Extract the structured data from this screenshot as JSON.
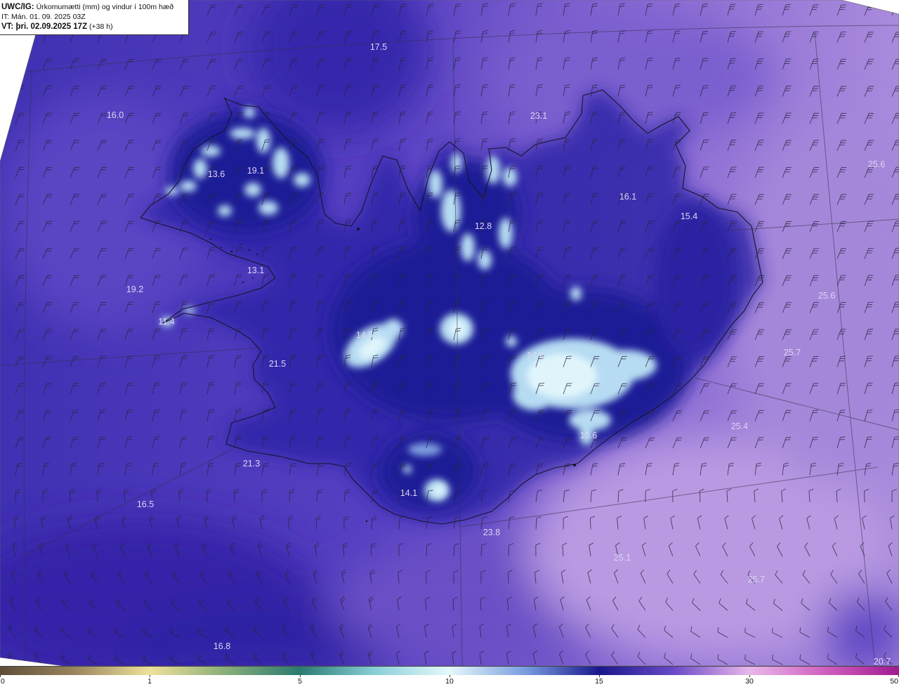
{
  "header": {
    "product": "UWC/IG:",
    "title": "Úrkomumætti (mm) og vindur í 100m hæð",
    "init_time": "IT: Mán. 01. 09. 2025 03Z",
    "valid_time": "VT: þri. 02.09.2025 17Z",
    "lead_time": "(+38 h)"
  },
  "map": {
    "value_labels": [
      "17.5",
      "16.0",
      "23.1",
      "25.6",
      "13.6",
      "19.1",
      "16.1",
      "15.4",
      "12.8",
      "13.1",
      "19.2",
      "25.6",
      "11.4",
      "14.5",
      "25.7",
      "14.2",
      "21.5",
      "25.4",
      "10.6",
      "21.3",
      "14.1",
      "16.5",
      "23.8",
      "25.1",
      "25.7",
      "16.8",
      "20.7"
    ]
  },
  "colorbar": {
    "ticks": [
      "0",
      "1",
      "5",
      "10",
      "15",
      "30",
      "50"
    ],
    "colors": [
      "#5e4e38",
      "#eee29a",
      "#2a7a70",
      "#e6f8fb",
      "#1a178c",
      "#e9b8ea",
      "#a01a90"
    ],
    "mid_colors": [
      "#9a8560",
      "#8aae7a",
      "#88cfd8",
      "#7a9ee0",
      "#6a4ac8",
      "#d060c0"
    ]
  }
}
